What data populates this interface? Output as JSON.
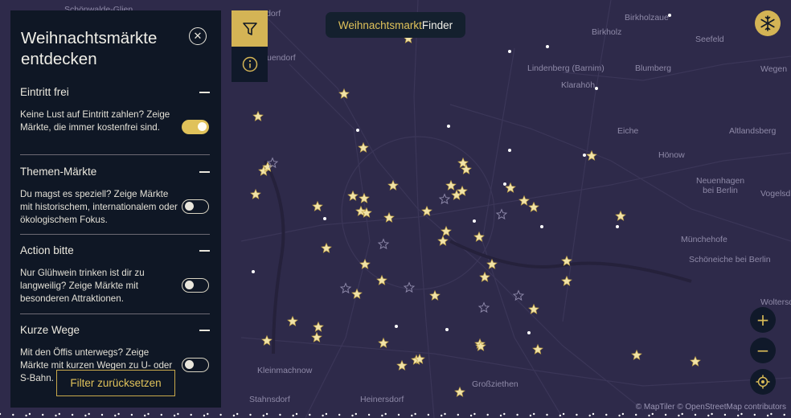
{
  "app": {
    "brand_part1": "Weihnachtsmarkt",
    "brand_part2": "Finder",
    "colors": {
      "accent": "#d4b455",
      "panel": "#0f1725",
      "map_bg": "#2e2a4a",
      "star": "#f1e3a8"
    }
  },
  "panel": {
    "title": "Weihnachtsmärkte entdecken",
    "close_icon": "close-icon",
    "sections": [
      {
        "title": "Eintritt frei",
        "description": "Keine Lust auf Eintritt zahlen? Zeige Märkte, die immer kostenfrei sind.",
        "enabled": true
      },
      {
        "title": "Themen-Märkte",
        "description": "Du magst es speziell? Zeige Märkte mit historischem, internationalem oder ökologischem Fokus.",
        "enabled": false
      },
      {
        "title": "Action bitte",
        "description": "Nur Glühwein trinken ist dir zu langweilig? Zeige Märkte mit besonderen Attraktionen.",
        "enabled": false
      },
      {
        "title": "Kurze Wege",
        "description": "Mit den Öffis unterwegs? Zeige Märkte mit kurzen Wegen zu U- oder S-Bahn.",
        "enabled": false
      }
    ],
    "reset_label": "Filter zurücksetzen"
  },
  "toolbar": {
    "filter_icon": "filter-icon",
    "info_icon": "info-icon"
  },
  "map": {
    "attribution": "© MapTiler © OpenStreetMap contributors",
    "zoom_in_label": "+",
    "zoom_out_label": "−",
    "places": [
      "Schönwalde-Glien",
      "Birkholzaue",
      "Birkholz",
      "Seefeld",
      "Wegen",
      "Lindenberg (Barnim)",
      "Blumberg",
      "Klarahöh",
      "Eiche",
      "Altlandsberg",
      "Hönow",
      "Neuenhagen bei Berlin",
      "Vogelsd",
      "Münchehofe",
      "Schöneiche bei Berlin",
      "Woltersd",
      "Kleinmachnow",
      "Großziethen",
      "Stahnsdorf",
      "Heinersdorf",
      "gsdorf",
      "uendorf"
    ]
  }
}
